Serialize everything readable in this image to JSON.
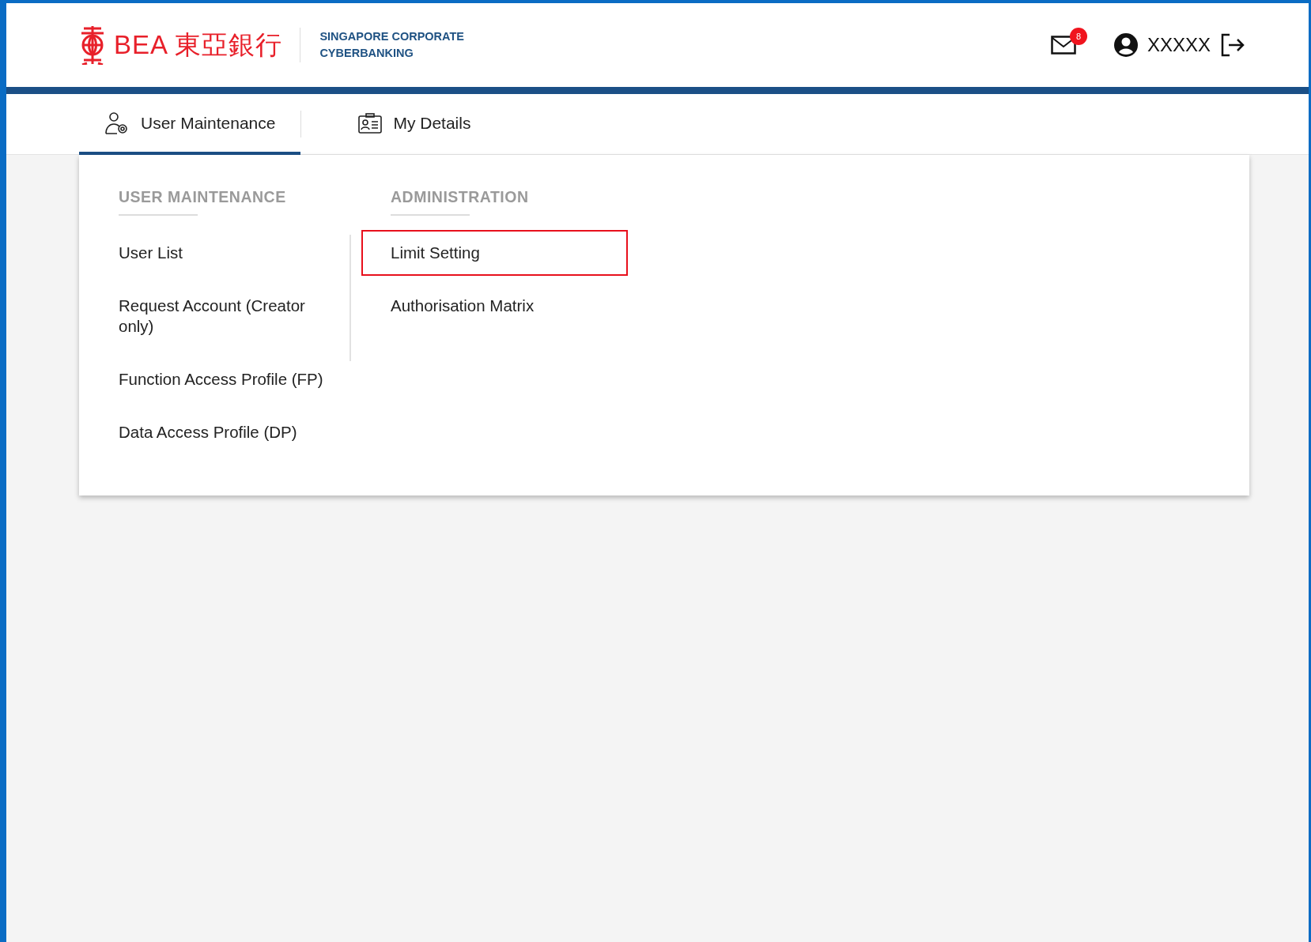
{
  "header": {
    "logo_text": "BEA 東亞銀行",
    "tagline": [
      "SINGAPORE CORPORATE",
      "CYBERBANKING"
    ],
    "mail_badge": "8",
    "user_name": "XXXXX"
  },
  "tabs": [
    {
      "label": "User Maintenance",
      "kind": "user-gear",
      "selected": true
    },
    {
      "label": "My Details",
      "kind": "id-card",
      "selected": false
    }
  ],
  "menu": {
    "columns": [
      {
        "heading": "USER MAINTENANCE",
        "items": [
          {
            "label": "User List",
            "highlighted": false
          },
          {
            "label": "Request Account (Creator only)",
            "highlighted": false
          },
          {
            "label": "Function Access Profile (FP)",
            "highlighted": false
          },
          {
            "label": "Data Access Profile (DP)",
            "highlighted": false
          }
        ]
      },
      {
        "heading": "ADMINISTRATION",
        "items": [
          {
            "label": "Limit Setting",
            "highlighted": true
          },
          {
            "label": "Authorisation Matrix",
            "highlighted": false
          }
        ]
      }
    ]
  }
}
